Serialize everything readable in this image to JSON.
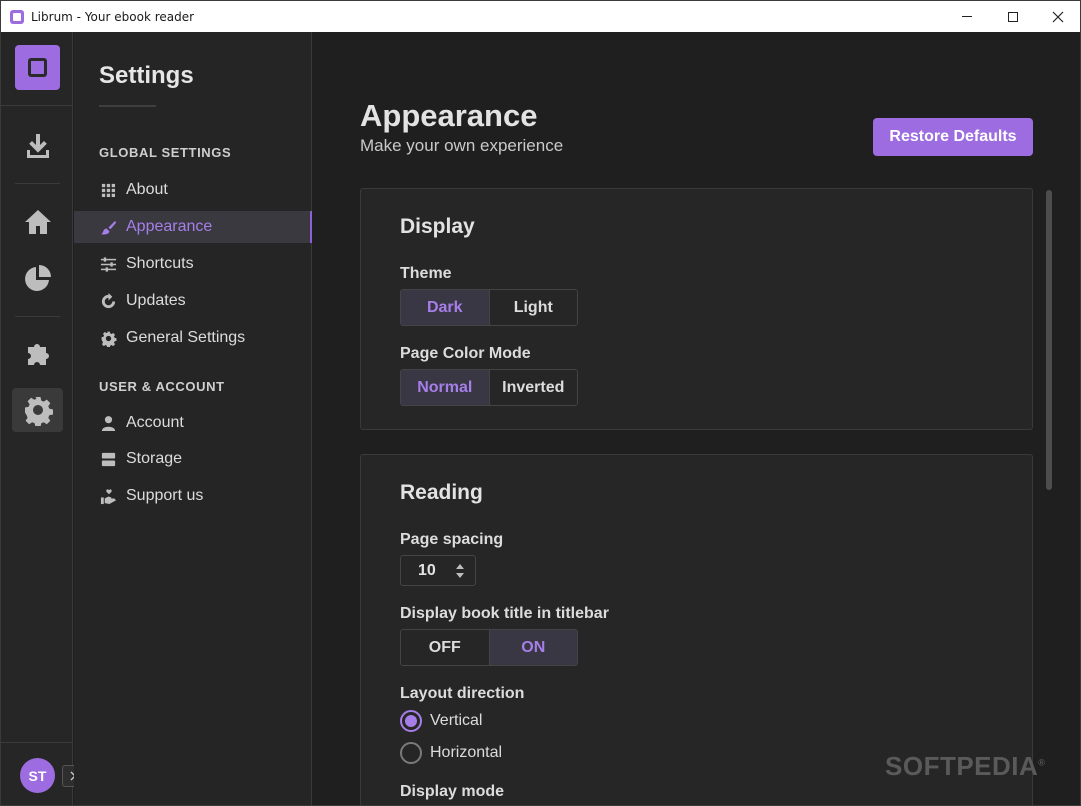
{
  "window": {
    "title": "Librum - Your ebook reader"
  },
  "rail": {
    "items": [
      {
        "name": "download-icon"
      },
      {
        "name": "home-icon"
      },
      {
        "name": "statistics-icon"
      },
      {
        "name": "plugins-icon"
      },
      {
        "name": "settings-icon",
        "active": true
      }
    ],
    "avatar_initials": "ST"
  },
  "sidebar": {
    "title": "Settings",
    "groups": [
      {
        "header": "GLOBAL SETTINGS",
        "items": [
          {
            "label": "About",
            "icon": "grid-icon"
          },
          {
            "label": "Appearance",
            "icon": "brush-icon",
            "active": true
          },
          {
            "label": "Shortcuts",
            "icon": "sliders-icon"
          },
          {
            "label": "Updates",
            "icon": "refresh-icon"
          },
          {
            "label": "General Settings",
            "icon": "gear-icon"
          }
        ]
      },
      {
        "header": "USER & ACCOUNT",
        "items": [
          {
            "label": "Account",
            "icon": "person-icon"
          },
          {
            "label": "Storage",
            "icon": "storage-icon"
          },
          {
            "label": "Support us",
            "icon": "hand-heart-icon"
          }
        ]
      }
    ]
  },
  "main": {
    "title": "Appearance",
    "subtitle": "Make your own experience",
    "restore_button": "Restore Defaults",
    "display": {
      "title": "Display",
      "theme_label": "Theme",
      "theme_options": [
        "Dark",
        "Light"
      ],
      "theme_selected": "Dark",
      "color_mode_label": "Page Color Mode",
      "color_mode_options": [
        "Normal",
        "Inverted"
      ],
      "color_mode_selected": "Normal"
    },
    "reading": {
      "title": "Reading",
      "spacing_label": "Page spacing",
      "spacing_value": "10",
      "titlebar_label": "Display book title in titlebar",
      "titlebar_options": [
        "OFF",
        "ON"
      ],
      "titlebar_selected": "ON",
      "layout_label": "Layout direction",
      "layout_options": [
        "Vertical",
        "Horizontal"
      ],
      "layout_selected": "Vertical",
      "display_mode_label": "Display mode"
    }
  },
  "watermark": "SOFTPEDIA",
  "colors": {
    "accent": "#9d6ce0",
    "background": "#1f1f1f",
    "panel": "#262626"
  }
}
